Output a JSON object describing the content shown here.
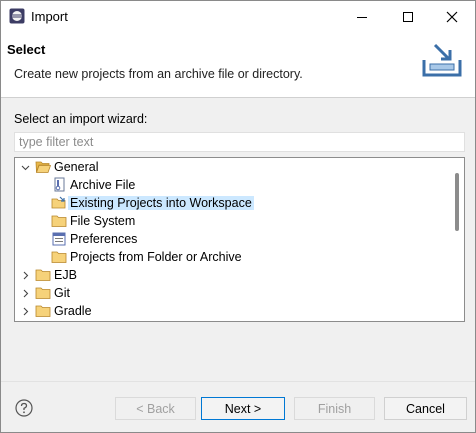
{
  "window": {
    "title": "Import"
  },
  "banner": {
    "title": "Select",
    "description": "Create new projects from an archive file or directory."
  },
  "wizard": {
    "label": "Select an import wizard:",
    "filter_placeholder": "type filter text",
    "filter_value": ""
  },
  "tree": {
    "items": [
      {
        "label": "General",
        "icon": "folder-open-icon",
        "expanded": true,
        "level": 0
      },
      {
        "label": "Archive File",
        "icon": "archive-file-icon",
        "level": 1
      },
      {
        "label": "Existing Projects into Workspace",
        "icon": "existing-projects-icon",
        "level": 1,
        "selected": true
      },
      {
        "label": "File System",
        "icon": "folder-icon",
        "level": 1
      },
      {
        "label": "Preferences",
        "icon": "preferences-icon",
        "level": 1
      },
      {
        "label": "Projects from Folder or Archive",
        "icon": "folder-icon",
        "level": 1
      },
      {
        "label": "EJB",
        "icon": "folder-icon",
        "expanded": false,
        "level": 0
      },
      {
        "label": "Git",
        "icon": "folder-icon",
        "expanded": false,
        "level": 0
      },
      {
        "label": "Gradle",
        "icon": "folder-icon",
        "expanded": false,
        "level": 0
      }
    ]
  },
  "buttons": {
    "back": "< Back",
    "next": "Next >",
    "finish": "Finish",
    "cancel": "Cancel"
  },
  "colors": {
    "selection": "#cce8ff",
    "primary_border": "#0078d4",
    "folder": "#e8b84a"
  }
}
